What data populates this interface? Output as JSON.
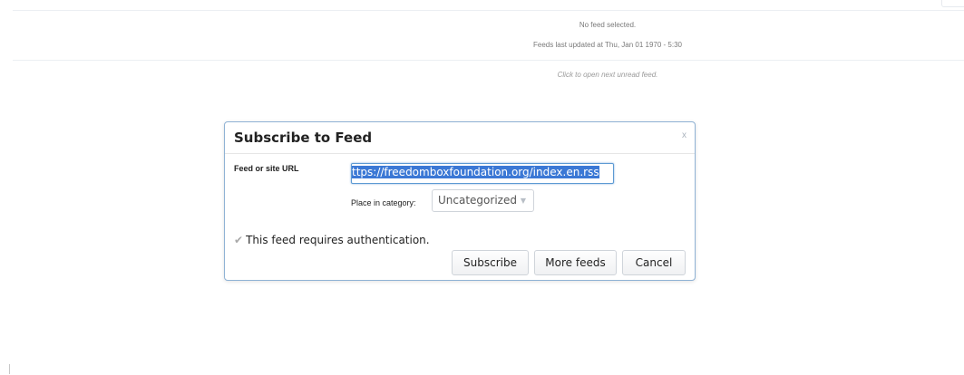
{
  "background_status": {
    "no_feed": "No feed selected.",
    "last_updated": "Feeds last updated at Thu, Jan 01 1970 - 5:30",
    "next_unread": "Click to open next unread feed."
  },
  "dialog": {
    "title": "Subscribe to Feed",
    "close_label": "x",
    "url_label": "Feed or site URL",
    "url_value": "https://freedomboxfoundation.org/index.en.rss",
    "url_visible": "ttps://freedomboxfoundation.org/index.en.rss",
    "category_label": "Place in category:",
    "category_selected": "Uncategorized",
    "category_arrow": "▼",
    "auth_icon": "✔",
    "auth_label": "This feed requires authentication.",
    "buttons": {
      "subscribe": "Subscribe",
      "more_feeds": "More feeds",
      "cancel": "Cancel"
    }
  },
  "colors": {
    "dialog_border": "#8fb2d4",
    "selection": "#3b78d5",
    "input_focus": "#5d9ad3"
  }
}
